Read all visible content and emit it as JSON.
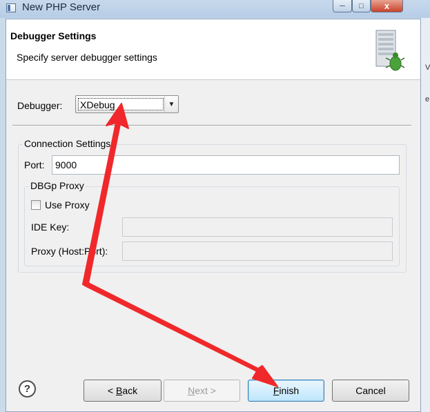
{
  "window": {
    "title": "New PHP Server",
    "close_glyph": "x"
  },
  "header": {
    "title": "Debugger Settings",
    "description": "Specify server debugger settings",
    "icon": "server-bug-icon"
  },
  "debugger": {
    "label": "Debugger:",
    "selected": "XDebug"
  },
  "connection": {
    "group_title": "Connection Settings",
    "port_label": "Port:",
    "port_value": "9000",
    "proxy": {
      "group_title": "DBGp Proxy",
      "use_proxy_label": "Use Proxy",
      "use_proxy_checked": false,
      "ide_key_label": "IDE Key:",
      "ide_key_value": "",
      "proxy_host_port_label": "Proxy (Host:Port):",
      "proxy_host_port_value": ""
    }
  },
  "buttons": {
    "help_glyph": "?",
    "back": {
      "prefix": "< ",
      "mnemonic": "B",
      "rest": "ack"
    },
    "next": {
      "mnemonic": "N",
      "rest": "ext >"
    },
    "finish": {
      "mnemonic": "F",
      "rest": "inish"
    },
    "cancel": "Cancel"
  },
  "annotation": {
    "color": "#f0282b"
  },
  "background_fragments": [
    "V",
    "e"
  ]
}
